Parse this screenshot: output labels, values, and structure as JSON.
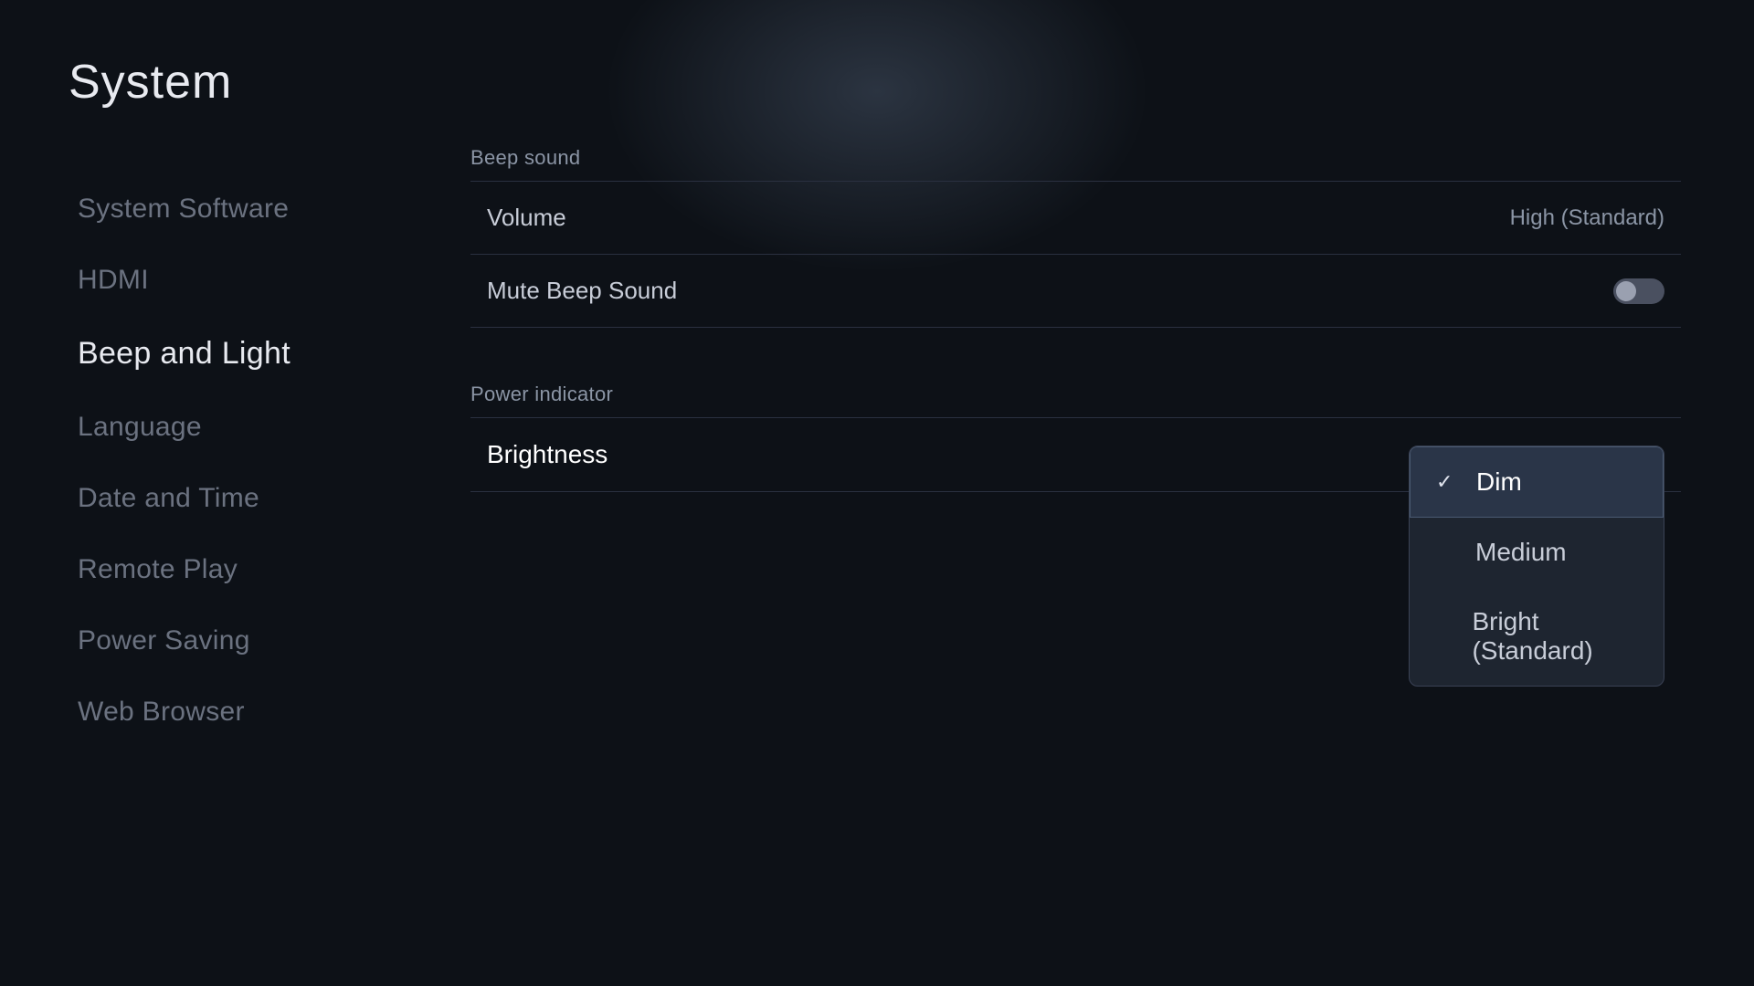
{
  "page": {
    "title": "System"
  },
  "sidebar": {
    "items": [
      {
        "id": "system-software",
        "label": "System Software",
        "active": false
      },
      {
        "id": "hdmi",
        "label": "HDMI",
        "active": false
      },
      {
        "id": "beep-and-light",
        "label": "Beep and Light",
        "active": true
      },
      {
        "id": "language",
        "label": "Language",
        "active": false
      },
      {
        "id": "date-and-time",
        "label": "Date and Time",
        "active": false
      },
      {
        "id": "remote-play",
        "label": "Remote Play",
        "active": false
      },
      {
        "id": "power-saving",
        "label": "Power Saving",
        "active": false
      },
      {
        "id": "web-browser",
        "label": "Web Browser",
        "active": false
      }
    ]
  },
  "main": {
    "beep_sound": {
      "section_label": "Beep sound",
      "items": [
        {
          "id": "volume",
          "label": "Volume",
          "value": "High (Standard)"
        },
        {
          "id": "mute-beep-sound",
          "label": "Mute Beep Sound",
          "value": "toggle"
        }
      ]
    },
    "power_indicator": {
      "section_label": "Power indicator",
      "items": [
        {
          "id": "brightness",
          "label": "Brightness",
          "has_dropdown": true
        }
      ]
    },
    "brightness_dropdown": {
      "options": [
        {
          "id": "dim",
          "label": "Dim",
          "selected": true
        },
        {
          "id": "medium",
          "label": "Medium",
          "selected": false
        },
        {
          "id": "bright-standard",
          "label": "Bright (Standard)",
          "selected": false
        }
      ]
    }
  },
  "icons": {
    "check": "✓"
  }
}
